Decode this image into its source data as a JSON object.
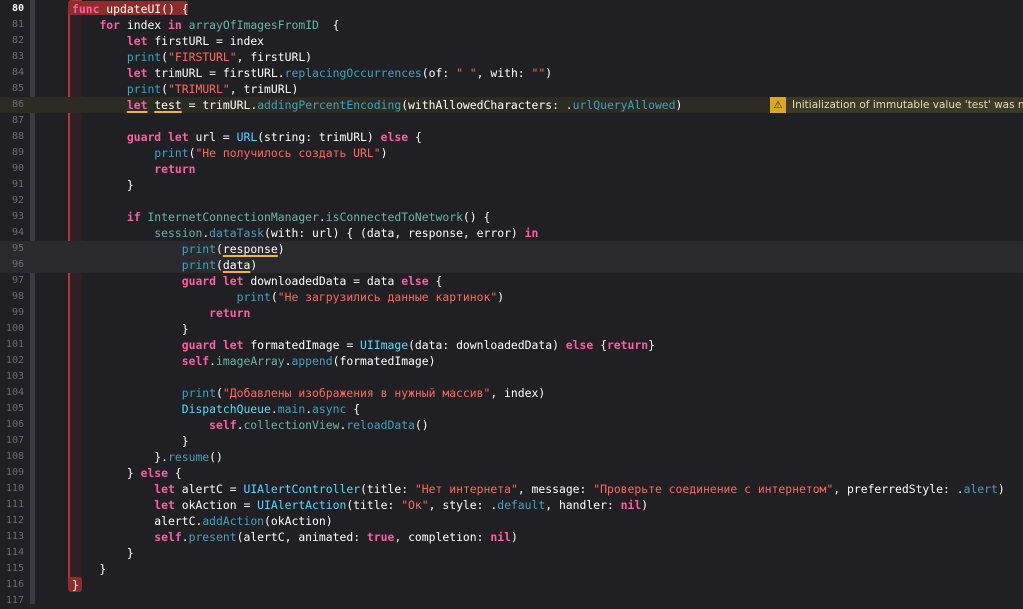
{
  "editor": {
    "lines": [
      {
        "n": "80",
        "code": [
          [
            "kw",
            "func "
          ],
          [
            "pl",
            "updateUI() {"
          ]
        ]
      },
      {
        "n": "81",
        "code": [
          [
            "pl",
            "    "
          ],
          [
            "kw",
            "for "
          ],
          [
            "pl",
            "index "
          ],
          [
            "kw",
            "in "
          ],
          [
            "fn",
            "arrayOfImagesFromID"
          ],
          [
            "pl",
            "  {"
          ]
        ]
      },
      {
        "n": "82",
        "code": [
          [
            "pl",
            "        "
          ],
          [
            "kw",
            "let "
          ],
          [
            "pl",
            "firstURL = index"
          ]
        ]
      },
      {
        "n": "83",
        "code": [
          [
            "pl",
            "        "
          ],
          [
            "mt",
            "print"
          ],
          [
            "pl",
            "("
          ],
          [
            "str",
            "\"FIRSTURL\""
          ],
          [
            "pl",
            ", firstURL)"
          ]
        ]
      },
      {
        "n": "84",
        "code": [
          [
            "pl",
            "        "
          ],
          [
            "kw",
            "let "
          ],
          [
            "pl",
            "trimURL = firstURL."
          ],
          [
            "mt",
            "replacingOccurrences"
          ],
          [
            "pl",
            "(of: "
          ],
          [
            "str",
            "\" \""
          ],
          [
            "pl",
            ", with: "
          ],
          [
            "str",
            "\"\""
          ],
          [
            "pl",
            ")"
          ]
        ]
      },
      {
        "n": "85",
        "code": [
          [
            "pl",
            "        "
          ],
          [
            "mt",
            "print"
          ],
          [
            "pl",
            "("
          ],
          [
            "str",
            "\"TRIMURL\""
          ],
          [
            "pl",
            ", trimURL)"
          ]
        ]
      },
      {
        "n": "86",
        "code": [
          [
            "pl",
            "        "
          ],
          [
            "kw ul",
            "let"
          ],
          [
            "pl",
            " "
          ],
          [
            "pl ul",
            "test"
          ],
          [
            "pl",
            " = trimURL."
          ],
          [
            "mt",
            "addingPercentEncoding"
          ],
          [
            "pl",
            "(withAllowedCharacters: ."
          ],
          [
            "mt",
            "urlQueryAllowed"
          ],
          [
            "pl",
            ")"
          ]
        ]
      },
      {
        "n": "87",
        "code": []
      },
      {
        "n": "88",
        "code": [
          [
            "pl",
            "        "
          ],
          [
            "kw",
            "guard let "
          ],
          [
            "pl",
            "url = "
          ],
          [
            "ty",
            "URL"
          ],
          [
            "pl",
            "(string: trimURL) "
          ],
          [
            "kw",
            "else "
          ],
          [
            "pl",
            "{"
          ]
        ]
      },
      {
        "n": "89",
        "code": [
          [
            "pl",
            "            "
          ],
          [
            "mt",
            "print"
          ],
          [
            "pl",
            "("
          ],
          [
            "str",
            "\"Не получилось создать URL\""
          ],
          [
            "pl",
            ")"
          ]
        ]
      },
      {
        "n": "90",
        "code": [
          [
            "pl",
            "            "
          ],
          [
            "kw",
            "return"
          ]
        ]
      },
      {
        "n": "91",
        "code": [
          [
            "pl",
            "        }"
          ]
        ]
      },
      {
        "n": "92",
        "code": []
      },
      {
        "n": "93",
        "code": [
          [
            "pl",
            "        "
          ],
          [
            "kw",
            "if "
          ],
          [
            "fn",
            "InternetConnectionManager"
          ],
          [
            "pl",
            "."
          ],
          [
            "fn",
            "isConnectedToNetwork"
          ],
          [
            "pl",
            "() {"
          ]
        ]
      },
      {
        "n": "94",
        "code": [
          [
            "pl",
            "            "
          ],
          [
            "fn",
            "session"
          ],
          [
            "pl",
            "."
          ],
          [
            "mt",
            "dataTask"
          ],
          [
            "pl",
            "(with: url) { (data, response, error) "
          ],
          [
            "kw",
            "in"
          ]
        ]
      },
      {
        "n": "95",
        "code": [
          [
            "pl",
            "                "
          ],
          [
            "mt",
            "print"
          ],
          [
            "pl",
            "("
          ],
          [
            "pl ul",
            "response"
          ],
          [
            "pl",
            ")"
          ]
        ]
      },
      {
        "n": "96",
        "code": [
          [
            "pl",
            "                "
          ],
          [
            "mt",
            "print"
          ],
          [
            "pl",
            "("
          ],
          [
            "pl ul",
            "data"
          ],
          [
            "pl",
            ")"
          ]
        ]
      },
      {
        "n": "97",
        "code": [
          [
            "pl",
            "                "
          ],
          [
            "kw",
            "guard let "
          ],
          [
            "pl",
            "downloadedData = data "
          ],
          [
            "kw",
            "else "
          ],
          [
            "pl",
            "{"
          ]
        ]
      },
      {
        "n": "98",
        "code": [
          [
            "pl",
            "                        "
          ],
          [
            "mt",
            "print"
          ],
          [
            "pl",
            "("
          ],
          [
            "str",
            "\"Не загрузились данные картинок\""
          ],
          [
            "pl",
            ")"
          ]
        ]
      },
      {
        "n": "99",
        "code": [
          [
            "pl",
            "                    "
          ],
          [
            "kw",
            "return"
          ]
        ]
      },
      {
        "n": "100",
        "code": [
          [
            "pl",
            "                }"
          ]
        ]
      },
      {
        "n": "101",
        "code": [
          [
            "pl",
            "                "
          ],
          [
            "kw",
            "guard let "
          ],
          [
            "pl",
            "formatedImage = "
          ],
          [
            "ty",
            "UIImage"
          ],
          [
            "pl",
            "(data: downloadedData) "
          ],
          [
            "kw",
            "else "
          ],
          [
            "pl",
            "{"
          ],
          [
            "kw",
            "return"
          ],
          [
            "pl",
            "}"
          ]
        ]
      },
      {
        "n": "102",
        "code": [
          [
            "pl",
            "                "
          ],
          [
            "kw",
            "self"
          ],
          [
            "pl",
            "."
          ],
          [
            "fn",
            "imageArray"
          ],
          [
            "pl",
            "."
          ],
          [
            "mt",
            "append"
          ],
          [
            "pl",
            "(formatedImage)"
          ]
        ]
      },
      {
        "n": "103",
        "code": []
      },
      {
        "n": "104",
        "code": [
          [
            "pl",
            "                "
          ],
          [
            "mt",
            "print"
          ],
          [
            "pl",
            "("
          ],
          [
            "str",
            "\"Добавлены изображения в нужный массив\""
          ],
          [
            "pl",
            ", index)"
          ]
        ]
      },
      {
        "n": "105",
        "code": [
          [
            "pl",
            "                "
          ],
          [
            "ty",
            "DispatchQueue"
          ],
          [
            "pl",
            "."
          ],
          [
            "mt",
            "main"
          ],
          [
            "pl",
            "."
          ],
          [
            "mt",
            "async"
          ],
          [
            "pl",
            " {"
          ]
        ]
      },
      {
        "n": "106",
        "code": [
          [
            "pl",
            "                    "
          ],
          [
            "kw",
            "self"
          ],
          [
            "pl",
            "."
          ],
          [
            "fn",
            "collectionView"
          ],
          [
            "pl",
            "."
          ],
          [
            "mt",
            "reloadData"
          ],
          [
            "pl",
            "()"
          ]
        ]
      },
      {
        "n": "107",
        "code": [
          [
            "pl",
            "                }"
          ]
        ]
      },
      {
        "n": "108",
        "code": [
          [
            "pl",
            "            }."
          ],
          [
            "mt",
            "resume"
          ],
          [
            "pl",
            "()"
          ]
        ]
      },
      {
        "n": "109",
        "code": [
          [
            "pl",
            "        } "
          ],
          [
            "kw",
            "else "
          ],
          [
            "pl",
            "{"
          ]
        ]
      },
      {
        "n": "110",
        "code": [
          [
            "pl",
            "            "
          ],
          [
            "kw",
            "let "
          ],
          [
            "pl",
            "alertC = "
          ],
          [
            "ty",
            "UIAlertController"
          ],
          [
            "pl",
            "(title: "
          ],
          [
            "str",
            "\"Нет интернета\""
          ],
          [
            "pl",
            ", message: "
          ],
          [
            "str",
            "\"Проверьте соединение с интернетом\""
          ],
          [
            "pl",
            ", preferredStyle: ."
          ],
          [
            "mt",
            "alert"
          ],
          [
            "pl",
            ")"
          ]
        ]
      },
      {
        "n": "111",
        "code": [
          [
            "pl",
            "            "
          ],
          [
            "kw",
            "let "
          ],
          [
            "pl",
            "okAction = "
          ],
          [
            "ty",
            "UIAlertAction"
          ],
          [
            "pl",
            "(title: "
          ],
          [
            "str",
            "\"Ок\""
          ],
          [
            "pl",
            ", style: ."
          ],
          [
            "mt",
            "default"
          ],
          [
            "pl",
            ", handler: "
          ],
          [
            "kw",
            "nil"
          ],
          [
            "pl",
            ")"
          ]
        ]
      },
      {
        "n": "112",
        "code": [
          [
            "pl",
            "            alertC."
          ],
          [
            "mt",
            "addAction"
          ],
          [
            "pl",
            "(okAction)"
          ]
        ]
      },
      {
        "n": "113",
        "code": [
          [
            "pl",
            "            "
          ],
          [
            "kw",
            "self"
          ],
          [
            "pl",
            "."
          ],
          [
            "mt",
            "present"
          ],
          [
            "pl",
            "(alertC, animated: "
          ],
          [
            "kw",
            "true"
          ],
          [
            "pl",
            ", completion: "
          ],
          [
            "kw",
            "nil"
          ],
          [
            "pl",
            ")"
          ]
        ]
      },
      {
        "n": "114",
        "code": [
          [
            "pl",
            "        }"
          ]
        ]
      },
      {
        "n": "115",
        "code": [
          [
            "pl",
            "    }"
          ]
        ]
      },
      {
        "n": "116",
        "code": [
          [
            "pl",
            "}"
          ]
        ]
      },
      {
        "n": "117",
        "code": []
      }
    ],
    "warning_text": "Initialization of immutable value 'test' was never used",
    "warning_icon": "warning-triangle-icon"
  }
}
